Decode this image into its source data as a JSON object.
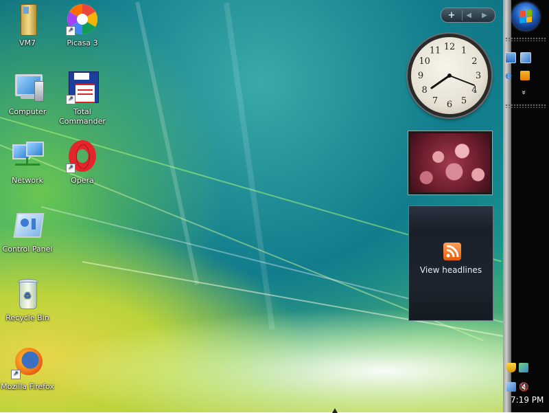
{
  "desktop": {
    "icons": [
      {
        "label": "VM7",
        "icon": "folder-icon",
        "shortcut": false
      },
      {
        "label": "Picasa 3",
        "icon": "picasa-icon",
        "shortcut": true
      },
      {
        "label": "Computer",
        "icon": "computer-icon",
        "shortcut": false
      },
      {
        "label": "Total Commander",
        "icon": "total-commander-icon",
        "shortcut": true
      },
      {
        "label": "Network",
        "icon": "network-icon",
        "shortcut": false
      },
      {
        "label": "Opera",
        "icon": "opera-icon",
        "shortcut": true
      },
      {
        "label": "Control Panel",
        "icon": "control-panel-icon",
        "shortcut": false
      },
      {
        "label": "Recycle Bin",
        "icon": "recycle-bin-icon",
        "shortcut": false
      },
      {
        "label": "Mozilla Firefox",
        "icon": "firefox-icon",
        "shortcut": true
      }
    ]
  },
  "gadgets": {
    "toolbar": {
      "add": "+",
      "prev": "◀",
      "next": "▶"
    },
    "clock": {
      "numerals": [
        "12",
        "1",
        "2",
        "3",
        "4",
        "5",
        "6",
        "7",
        "8",
        "9",
        "10",
        "11"
      ],
      "time": "7:19"
    },
    "feed": {
      "label": "View headlines",
      "icon": "rss-icon"
    },
    "slideshow": {
      "icon": "photo-slideshow-icon"
    }
  },
  "taskbar": {
    "start_icon": "windows-start-orb",
    "quick_launch": [
      "show-desktop-icon",
      "switch-windows-icon",
      "internet-explorer-icon",
      "media-player-icon"
    ],
    "expand": "»",
    "tray": [
      "security-icon",
      "network-tray-icon",
      "network-connection-icon",
      "volume-muted-icon"
    ],
    "clock": "7:19 PM"
  },
  "colors": {
    "accent": "#1f5dbf",
    "taskbar": "#060606"
  }
}
